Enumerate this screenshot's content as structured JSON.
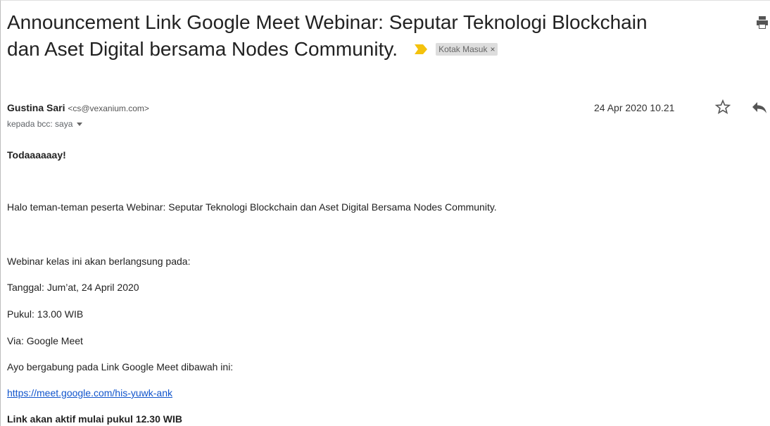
{
  "email": {
    "subject_line1": "Announcement Link Google Meet Webinar: Seputar Teknologi Blockchain",
    "subject_line2": "dan Aset Digital bersama Nodes Community.",
    "label": "Kotak Masuk",
    "label_remove": "×",
    "sender_name": "Gustina Sari",
    "sender_email": "<cs@vexanium.com>",
    "recipients": "kepada bcc: saya",
    "date": "24 Apr 2020 10.21"
  },
  "body": {
    "greeting": "Todaaaaaay!",
    "intro": "Halo teman-teman peserta Webinar: Seputar Teknologi Blockchain dan Aset Digital Bersama Nodes Community.",
    "schedule_intro": "Webinar kelas ini akan berlangsung pada:",
    "date_line": "Tanggal: Jum’at, 24 April 2020",
    "time_line": "Pukul: 13.00 WIB",
    "via_line": "Via: Google Meet",
    "join_line": "Ayo bergabung pada Link Google Meet dibawah ini:",
    "meet_link": "https://meet.google.com/his-yuwk-ank",
    "active_note": "Link akan aktif mulai pukul 12.30 WIB"
  },
  "colors": {
    "important_marker": "#f4c20d",
    "link": "#1155cc",
    "label_bg": "#dddddd"
  },
  "icons": {
    "print": "print-icon",
    "important": "important-marker-icon",
    "star": "star-icon",
    "reply": "reply-icon",
    "recipients_toggle": "chevron-down-icon"
  }
}
